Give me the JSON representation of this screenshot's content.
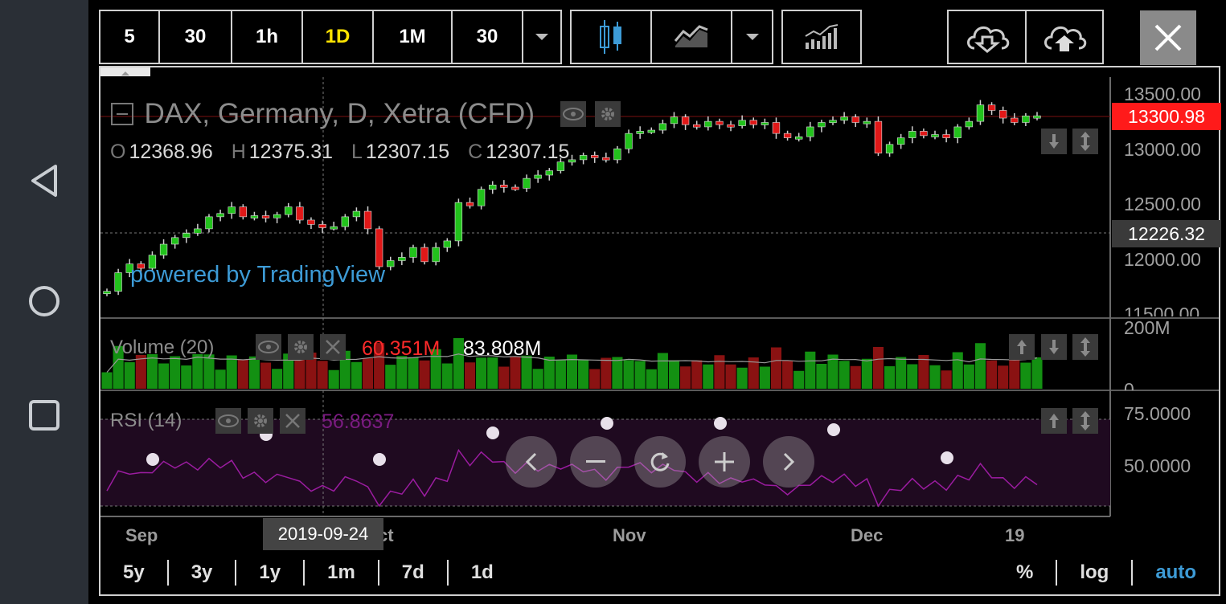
{
  "toolbar": {
    "intervals": [
      "5",
      "30",
      "1h",
      "1D",
      "1M",
      "30"
    ],
    "active_interval": "1D"
  },
  "chart": {
    "title": "DAX, Germany, D, Xetra (CFD)",
    "ohlc": {
      "o_label": "O",
      "o": "12368.96",
      "h_label": "H",
      "h": "12375.31",
      "l_label": "L",
      "l": "12307.15",
      "c_label": "C",
      "c": "12307.15"
    },
    "watermark": "powered by TradingView",
    "last_price": "13300.98",
    "crosshair_price": "12226.32",
    "crosshair_date": "2019-09-24",
    "price_axis": [
      "13500.00",
      "13000.00",
      "12500.00",
      "12000.00",
      "11500.00"
    ],
    "x_labels": [
      "Sep",
      "ct",
      "Nov",
      "Dec",
      "19"
    ]
  },
  "volume": {
    "title": "Volume (20)",
    "value1": "60.351M",
    "value2": "83.808M",
    "axis": [
      "200M",
      "0"
    ]
  },
  "rsi": {
    "title": "RSI (14)",
    "value": "56.8637",
    "axis": [
      "75.0000",
      "50.0000"
    ]
  },
  "ranges": [
    "5y",
    "3y",
    "1y",
    "1m",
    "7d",
    "1d"
  ],
  "scale_options": {
    "percent": "%",
    "log": "log",
    "auto": "auto"
  },
  "colors": {
    "up": "#22c21c",
    "down": "#e01818",
    "active": "#ffe400",
    "accent": "#3d9bd6",
    "last_price_bg": "#ff1a1a",
    "rsi_line": "#9b1ca0"
  },
  "chart_data": {
    "type": "candlestick",
    "x": [
      "2019-08-29",
      "2019-08-30",
      "2019-09-02",
      "2019-09-03",
      "2019-09-04",
      "2019-09-05",
      "2019-09-06",
      "2019-09-09",
      "2019-09-10",
      "2019-09-11",
      "2019-09-12",
      "2019-09-13",
      "2019-09-16",
      "2019-09-17",
      "2019-09-18",
      "2019-09-19",
      "2019-09-20",
      "2019-09-23",
      "2019-09-24",
      "2019-09-25",
      "2019-09-26",
      "2019-09-27",
      "2019-09-30",
      "2019-10-01",
      "2019-10-02",
      "2019-10-03",
      "2019-10-04",
      "2019-10-07",
      "2019-10-08",
      "2019-10-09",
      "2019-10-10",
      "2019-10-11",
      "2019-10-14",
      "2019-10-15",
      "2019-10-16",
      "2019-10-17",
      "2019-10-18",
      "2019-10-21",
      "2019-10-22",
      "2019-10-23",
      "2019-10-24",
      "2019-10-25",
      "2019-10-28",
      "2019-10-29",
      "2019-10-30",
      "2019-10-31",
      "2019-11-01",
      "2019-11-04",
      "2019-11-05",
      "2019-11-06",
      "2019-11-07",
      "2019-11-08",
      "2019-11-11",
      "2019-11-12",
      "2019-11-13",
      "2019-11-14",
      "2019-11-15",
      "2019-11-18",
      "2019-11-19",
      "2019-11-20",
      "2019-11-21",
      "2019-11-22",
      "2019-11-25",
      "2019-11-26",
      "2019-11-27",
      "2019-11-28",
      "2019-11-29",
      "2019-12-02",
      "2019-12-03",
      "2019-12-04",
      "2019-12-05",
      "2019-12-06",
      "2019-12-09",
      "2019-12-10",
      "2019-12-11",
      "2019-12-12",
      "2019-12-13",
      "2019-12-16",
      "2019-12-17",
      "2019-12-18",
      "2019-12-19",
      "2019-12-20",
      "2019-12-23"
    ],
    "close": [
      11700,
      11870,
      11950,
      11910,
      12030,
      12130,
      12190,
      12230,
      12270,
      12380,
      12410,
      12470,
      12380,
      12390,
      12370,
      12400,
      12470,
      12350,
      12310,
      12280,
      12290,
      12380,
      12430,
      12270,
      11925,
      11980,
      12010,
      12100,
      11970,
      12100,
      12160,
      12510,
      12480,
      12630,
      12670,
      12650,
      12640,
      12730,
      12760,
      12800,
      12880,
      12900,
      12940,
      12920,
      12900,
      13000,
      13140,
      13160,
      13170,
      13230,
      13290,
      13220,
      13200,
      13250,
      13220,
      13210,
      13260,
      13220,
      13240,
      13140,
      13100,
      13110,
      13200,
      13240,
      13260,
      13290,
      13240,
      13250,
      12960,
      13040,
      13100,
      13160,
      13120,
      13130,
      13100,
      13200,
      13250,
      13400,
      13350,
      13280,
      13240,
      13300,
      13300.98
    ],
    "ylim": [
      11500,
      13500
    ],
    "volume_axis": [
      0,
      200000000
    ],
    "rsi_axis": [
      50,
      75
    ]
  }
}
